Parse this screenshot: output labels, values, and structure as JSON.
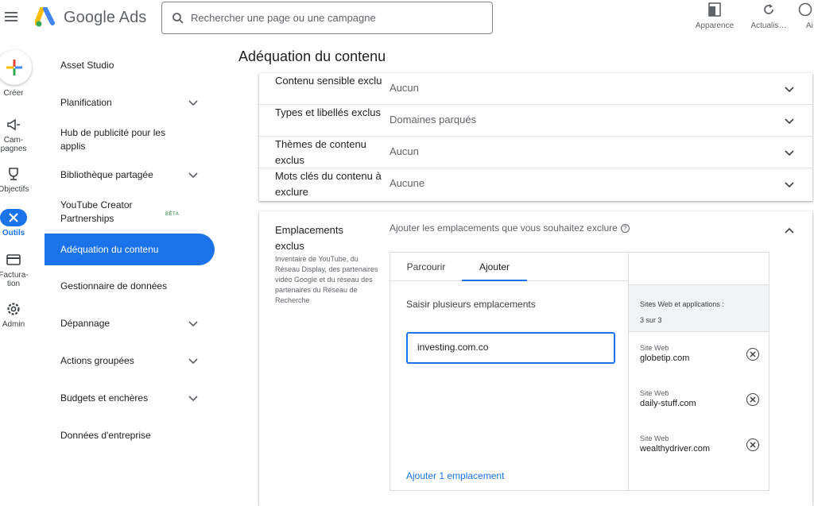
{
  "app": {
    "name": "Google Ads"
  },
  "search": {
    "placeholder": "Rechercher une page ou une campagne"
  },
  "top_actions": [
    {
      "label": "Apparence",
      "icon": "appearance-icon"
    },
    {
      "label": "Actualis…",
      "icon": "refresh-icon"
    },
    {
      "label": "Ai",
      "icon": "help-icon"
    }
  ],
  "rail": {
    "create": "Créer",
    "campaigns": "Cam-\npagnes",
    "goals": "Objectifs",
    "tools": "Outils",
    "billing": "Factura-\ntion",
    "admin": "Admin"
  },
  "nav": {
    "items": [
      {
        "label": "Asset Studio"
      },
      {
        "label": "Planification"
      },
      {
        "label": "Hub de publicité pour les applis"
      },
      {
        "label": "Bibliothèque partagée"
      },
      {
        "label": "YouTube Creator Partnerships",
        "badge": "BÊTA"
      },
      {
        "label": "Adéquation du contenu"
      },
      {
        "label": "Gestionnaire de données"
      },
      {
        "label": "Dépannage"
      },
      {
        "label": "Actions groupées"
      },
      {
        "label": "Budgets et enchères"
      },
      {
        "label": "Données d'entreprise"
      }
    ]
  },
  "page": {
    "title": "Adéquation du contenu"
  },
  "settings": [
    {
      "label": "Contenu sensible exclu",
      "value": "Aucun"
    },
    {
      "label": "Types et libellés exclus",
      "value": "Domaines parqués"
    },
    {
      "label": "Thèmes de contenu exclus",
      "value": "Aucun"
    },
    {
      "label": "Mots clés du contenu à exclure",
      "value": "Aucune"
    }
  ],
  "placements": {
    "title": "Emplacements exclus",
    "description": "Inventaire de YouTube, du Réseau Display, des partenaires vidéo Google et du réseau des partenaires du Réseau de Recherche",
    "prompt": "Ajouter les emplacements que vous souhaitez exclure",
    "tabs": [
      "Parcourir",
      "Ajouter"
    ],
    "multi_label": "Saisir plusieurs emplacements",
    "input_value": "investing.com.co",
    "add_link": "Ajouter 1 emplacement",
    "list_header": "Sites Web et applications :",
    "list_count": "3 sur 3",
    "sites": [
      {
        "type": "Site Web",
        "url": "globetip.com"
      },
      {
        "type": "Site Web",
        "url": "daily-stuff.com"
      },
      {
        "type": "Site Web",
        "url": "wealthydriver.com"
      }
    ]
  },
  "colors": {
    "accent": "#1a73e8",
    "text": "#202124",
    "muted": "#5f6368"
  }
}
